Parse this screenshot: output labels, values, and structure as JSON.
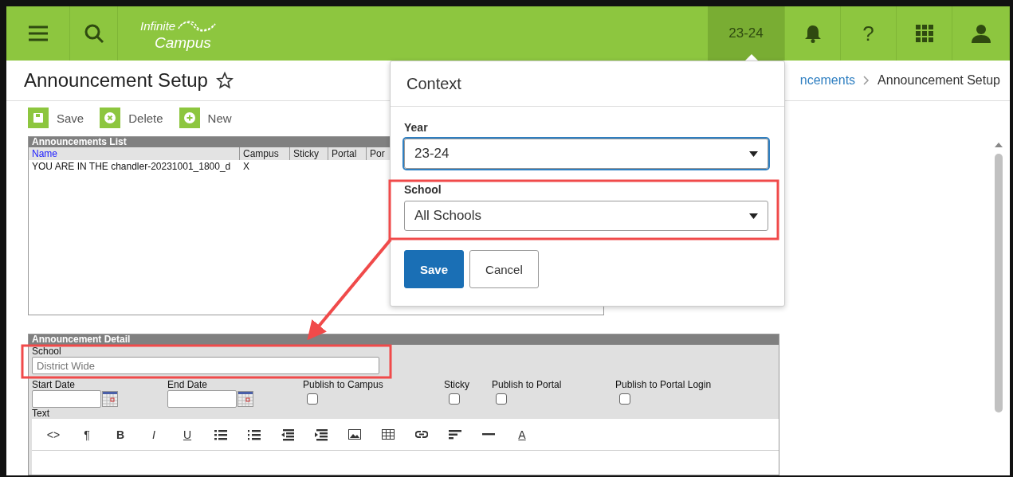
{
  "header": {
    "logo": {
      "line1": "Infinite",
      "line2": "Campus"
    },
    "year_button": "23-24",
    "help_button": "?"
  },
  "page": {
    "title": "Announcement Setup",
    "favorite": false,
    "breadcrumb": [
      {
        "label": "ncements",
        "kind": "link"
      },
      {
        "label": "Announcement Setup",
        "kind": "current"
      }
    ]
  },
  "toolbar": [
    {
      "label": "Save",
      "kind": "save"
    },
    {
      "label": "Delete",
      "kind": "delete"
    },
    {
      "label": "New",
      "kind": "new"
    }
  ],
  "announcements_list": {
    "title": "Announcements List",
    "columns": [
      "Name",
      "Campus",
      "Sticky",
      "Portal",
      "Por"
    ],
    "rows": [
      {
        "cells": [
          "YOU ARE IN THE chandler-20231001_1800_d",
          "X",
          "",
          "",
          ""
        ]
      }
    ]
  },
  "announcement_detail": {
    "title": "Announcement Detail",
    "school_label": "School",
    "school_placeholder": "District Wide",
    "dates": [
      {
        "label": "Start Date"
      },
      {
        "label": "End Date"
      }
    ],
    "checkboxes": [
      {
        "label": "Publish to Campus",
        "checked": false
      },
      {
        "label": "Sticky",
        "checked": false
      },
      {
        "label": "Publish to Portal",
        "checked": false
      },
      {
        "label": "Publish to Portal Login",
        "checked": false
      }
    ],
    "text_label": "Text",
    "editor_tools": [
      {
        "kind": "glyph",
        "label": "<>"
      },
      {
        "kind": "glyph",
        "label": "¶"
      },
      {
        "kind": "bold",
        "label": "B"
      },
      {
        "kind": "italic",
        "label": "I"
      },
      {
        "kind": "underline",
        "label": "U"
      },
      {
        "kind": "bullets"
      },
      {
        "kind": "numbered"
      },
      {
        "kind": "outdent"
      },
      {
        "kind": "indent"
      },
      {
        "kind": "image"
      },
      {
        "kind": "table"
      },
      {
        "kind": "link"
      },
      {
        "kind": "align"
      },
      {
        "kind": "rule"
      },
      {
        "kind": "underline",
        "label": "A"
      }
    ]
  },
  "context_popover": {
    "title": "Context",
    "fields": [
      {
        "label": "Year",
        "value": "23-24",
        "focused": true
      },
      {
        "label": "School",
        "value": "All Schools",
        "focused": false
      }
    ],
    "buttons": [
      {
        "label": "Save",
        "kind": "primary"
      },
      {
        "label": "Cancel",
        "kind": "secondary"
      }
    ]
  }
}
